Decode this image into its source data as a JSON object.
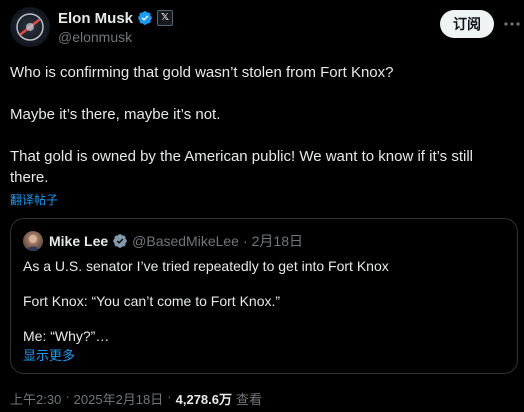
{
  "author": {
    "name": "Elon Musk",
    "handle": "@elonmusk",
    "x_badge": "𝕏"
  },
  "header": {
    "subscribe_label": "订阅"
  },
  "post": {
    "paragraphs": [
      "Who is confirming that gold wasn’t stolen from Fort Knox?",
      "Maybe it’s there, maybe it’s not.",
      "That gold is owned by the American public! We want to know if it’s still there."
    ],
    "translate_label": "翻译帖子"
  },
  "quote": {
    "author_name": "Mike Lee",
    "handle": "@BasedMikeLee",
    "dot": "·",
    "date": "2月18日",
    "lines": [
      "As a U.S. senator I’ve tried repeatedly to get into Fort Knox",
      "Fort Knox: “You can’t come to Fort Knox.”",
      "Me: “Why?”…"
    ],
    "show_more_label": "显示更多"
  },
  "meta": {
    "time": "上午2:30",
    "dot1": "·",
    "date": "2025年2月18日",
    "dot2": "·",
    "views_count": "4,278.6万",
    "views_label": "查看"
  },
  "colors": {
    "background": "#000000",
    "text": "#e7e9ea",
    "muted": "#71767b",
    "accent": "#1d9bf0",
    "border": "#2f3336"
  },
  "icons": {
    "verified": "verified-badge-icon",
    "more": "more-horizontal-icon"
  }
}
